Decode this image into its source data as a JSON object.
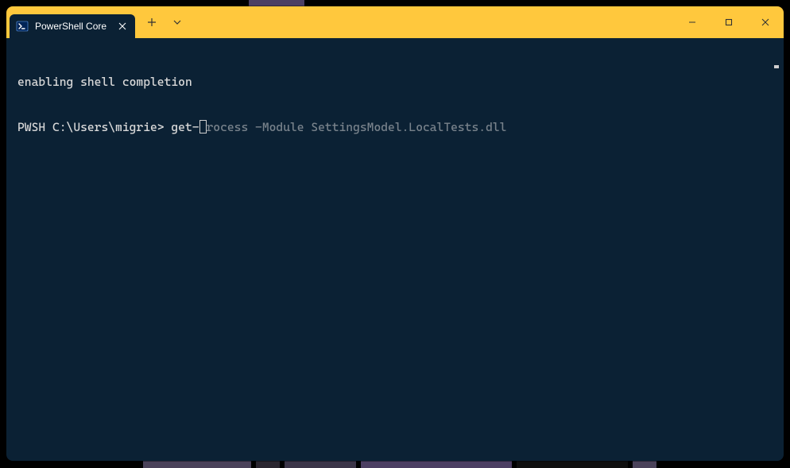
{
  "colors": {
    "accent": "#ffc83d",
    "terminal_bg": "#0b2134",
    "terminal_fg": "#d9d9d9",
    "suggestion_fg": "#78828b"
  },
  "titlebar": {
    "tab": {
      "title": "PowerShell Core",
      "icon": "powershell-icon"
    },
    "new_tab_label": "+",
    "dropdown_label": "v"
  },
  "window_controls": {
    "minimize": "minimize",
    "maximize": "maximize",
    "close": "close"
  },
  "terminal": {
    "lines": [
      "enabling shell completion"
    ],
    "prompt_prefix": "PWSH C:\\Users\\migrie> ",
    "typed": "get-",
    "suggestion": "rocess -Module SettingsModel.LocalTests.dll"
  }
}
